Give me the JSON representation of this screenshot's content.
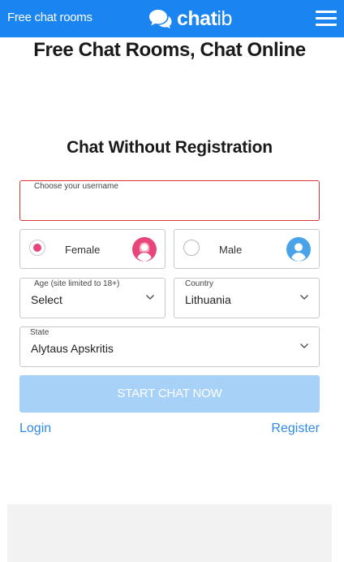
{
  "header": {
    "left_link": "Free chat rooms",
    "logo_bold": "chat",
    "logo_light": "ib",
    "brand_color": "#1a84f0"
  },
  "form": {
    "title": "Chat Without Registration",
    "username": {
      "label": "Choose your username",
      "value": ""
    },
    "gender": {
      "female_label": "Female",
      "male_label": "Male",
      "selected": "Female"
    },
    "age": {
      "label": "Age (site limited to 18+)",
      "value": "Select"
    },
    "country": {
      "label": "Country",
      "value": "Lithuania"
    },
    "state": {
      "label": "State",
      "value": "Alytaus Apskritis"
    },
    "start_button": "START CHAT NOW",
    "login_link": "Login",
    "register_link": "Register"
  },
  "section": {
    "title": "Free Chat Rooms, Chat Online"
  },
  "colors": {
    "accent": "#1a84f0",
    "error_border": "#d83535",
    "female": "#e8457a",
    "male": "#4aa3e8",
    "button_disabled": "#a7d1f7"
  }
}
